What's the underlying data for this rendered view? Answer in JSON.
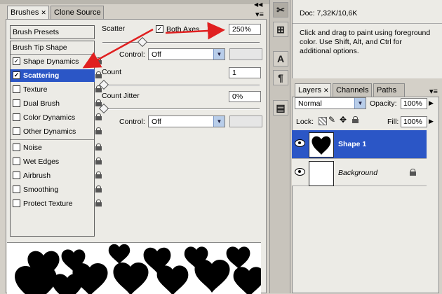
{
  "brushes_panel": {
    "tabs": [
      {
        "label": "Brushes"
      },
      {
        "label": "Clone Source"
      }
    ],
    "left_items": [
      {
        "label": "Brush Presets"
      },
      {
        "label": "Brush Tip Shape"
      },
      {
        "label": "Shape Dynamics",
        "checked": true
      },
      {
        "label": "Scattering",
        "checked": true,
        "selected": true
      },
      {
        "label": "Texture"
      },
      {
        "label": "Dual Brush"
      },
      {
        "label": "Color Dynamics"
      },
      {
        "label": "Other Dynamics"
      },
      {
        "label": "Noise"
      },
      {
        "label": "Wet Edges"
      },
      {
        "label": "Airbrush"
      },
      {
        "label": "Smoothing"
      },
      {
        "label": "Protect Texture"
      }
    ],
    "scatter_label": "Scatter",
    "both_axes_label": "Both Axes",
    "both_axes_checked": true,
    "scatter_value": "250%",
    "control_label": "Control:",
    "control_value": "Off",
    "count_label": "Count",
    "count_value": "1",
    "count_jitter_label": "Count Jitter",
    "count_jitter_value": "0%",
    "control2_label": "Control:",
    "control2_value": "Off"
  },
  "info_panel": {
    "doc_text": "Doc: 7,32K/10,6K",
    "hint_text": "Click and drag to paint using foreground color.  Use Shift, Alt, and Ctrl for additional options."
  },
  "layers_panel": {
    "tabs": [
      {
        "label": "Layers"
      },
      {
        "label": "Channels"
      },
      {
        "label": "Paths"
      }
    ],
    "blend_mode": "Normal",
    "opacity_label": "Opacity:",
    "opacity_value": "100%",
    "lock_label": "Lock:",
    "fill_label": "Fill:",
    "fill_value": "100%",
    "layers": [
      {
        "name": "Shape 1",
        "selected": true
      },
      {
        "name": "Background",
        "italic": true,
        "locked": true
      }
    ]
  },
  "colors": {
    "accent_blue": "#2b56c6",
    "annotation_red": "#e02020",
    "panel_gray": "#d4d0c8"
  }
}
